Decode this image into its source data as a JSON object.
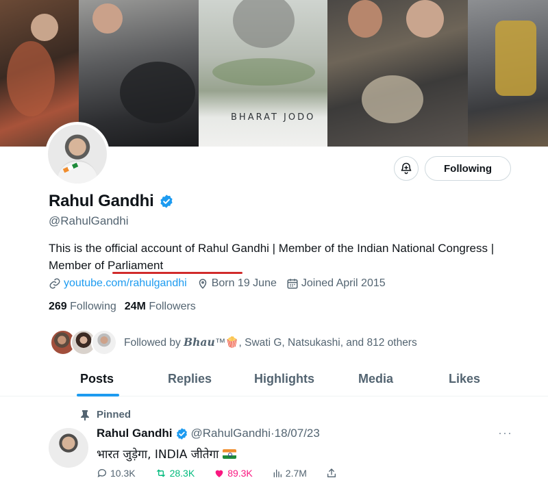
{
  "banner": {
    "caption": "BHARAT JODO"
  },
  "profile": {
    "name": "Rahul Gandhi",
    "handle": "@RahulGandhi",
    "bio": "This is the official account of Rahul Gandhi | Member of the Indian National Congress | Member of Parliament",
    "website": "youtube.com/rahulgandhi",
    "born": "Born 19 June",
    "joined": "Joined April 2015",
    "following_count": "269",
    "following_label": "Following",
    "followers_count": "24M",
    "followers_label": "Followers",
    "follow_button": "Following",
    "followed_by_prefix": "Followed by",
    "followed_by_styled": "𝑩𝒉𝒂𝒖",
    "followed_by_tm": "™🍿",
    "followed_by_rest": ", Swati G, Natsukashi, and 812 others"
  },
  "tabs": [
    {
      "label": "Posts",
      "active": true
    },
    {
      "label": "Replies",
      "active": false
    },
    {
      "label": "Highlights",
      "active": false
    },
    {
      "label": "Media",
      "active": false
    },
    {
      "label": "Likes",
      "active": false
    }
  ],
  "pinned_tweet": {
    "pinned_label": "Pinned",
    "name": "Rahul Gandhi",
    "handle": "@RahulGandhi",
    "separator": "·",
    "date": "18/07/23",
    "text": "भारत जुड़ेगा, INDIA जीतेगा",
    "replies": "10.3K",
    "retweets": "28.3K",
    "likes": "89.3K",
    "views": "2.7M",
    "more": "···"
  },
  "colors": {
    "accent": "#1d9bf0",
    "retweet_active": "#00ba7c",
    "like_active": "#f91880",
    "secondary_text": "#536471",
    "underline_annotation": "#d12b2b"
  },
  "icons": [
    "notification-bell-icon",
    "verified-badge-icon",
    "link-icon",
    "location-pin-icon",
    "calendar-icon",
    "pin-icon",
    "reply-icon",
    "retweet-icon",
    "heart-icon",
    "views-icon",
    "share-icon",
    "more-icon"
  ]
}
